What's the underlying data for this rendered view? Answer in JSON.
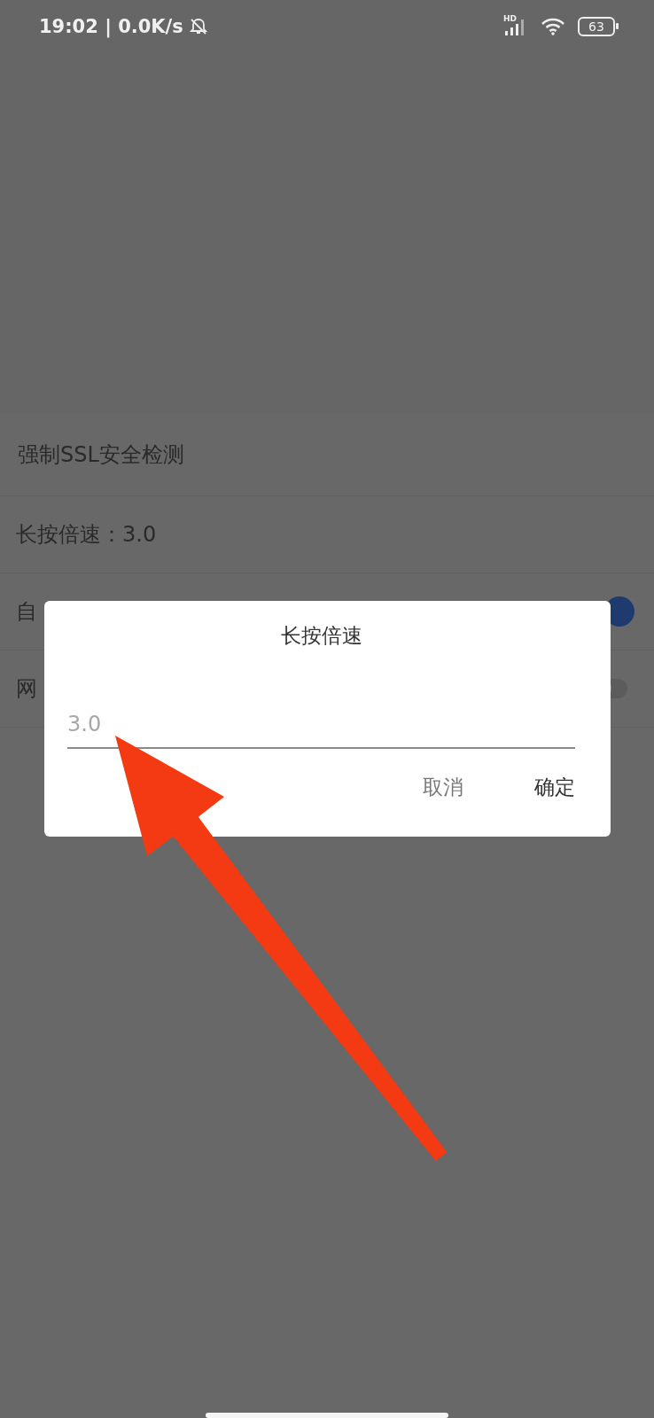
{
  "status_bar": {
    "time": "19:02 | 0.0K/s",
    "network_label": "HD",
    "battery": "63"
  },
  "settings": [
    {
      "kind": "text",
      "label": "强制SSL安全检测"
    },
    {
      "kind": "text",
      "label": "长按倍速：3.0"
    },
    {
      "kind": "toggle",
      "label": "自",
      "on": true
    },
    {
      "kind": "toggle",
      "label": "网",
      "on": false
    }
  ],
  "dialog": {
    "title": "长按倍速",
    "input": {
      "placeholder": "3.0"
    },
    "buttons": [
      "取消",
      "确定"
    ]
  }
}
